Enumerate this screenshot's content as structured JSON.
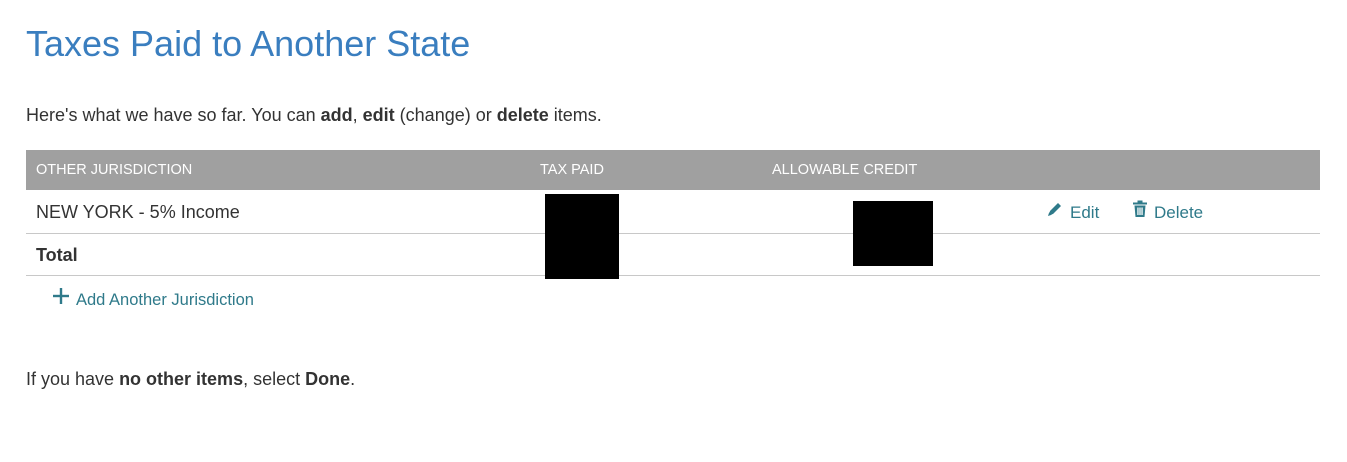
{
  "page": {
    "title": "Taxes Paid to Another State"
  },
  "intro": {
    "part1": "Here's what we have so far. You can ",
    "add": "add",
    "comma": ", ",
    "edit": "edit",
    "part2": " (change) or ",
    "delete": "delete",
    "part3": " items."
  },
  "table": {
    "columns": {
      "jurisdiction": "OTHER JURISDICTION",
      "tax_paid": "TAX PAID",
      "allowable_credit": "ALLOWABLE CREDIT"
    },
    "rows": [
      {
        "jurisdiction": "NEW YORK - 5% Income",
        "edit_label": "Edit",
        "delete_label": "Delete"
      }
    ],
    "total_label": "Total"
  },
  "add_jurisdiction": {
    "label": "Add Another Jurisdiction"
  },
  "outro": {
    "part1": "If you have ",
    "no_other_items": "no other items",
    "part2": ", select ",
    "done": "Done",
    "part3": "."
  },
  "icons": {
    "edit": "pencil-icon",
    "delete": "trash-icon",
    "add": "plus-icon"
  },
  "colors": {
    "title": "#3a7ebf",
    "link": "#2f7a8a",
    "header_bg": "#a0a0a0",
    "redaction": "#000000"
  }
}
